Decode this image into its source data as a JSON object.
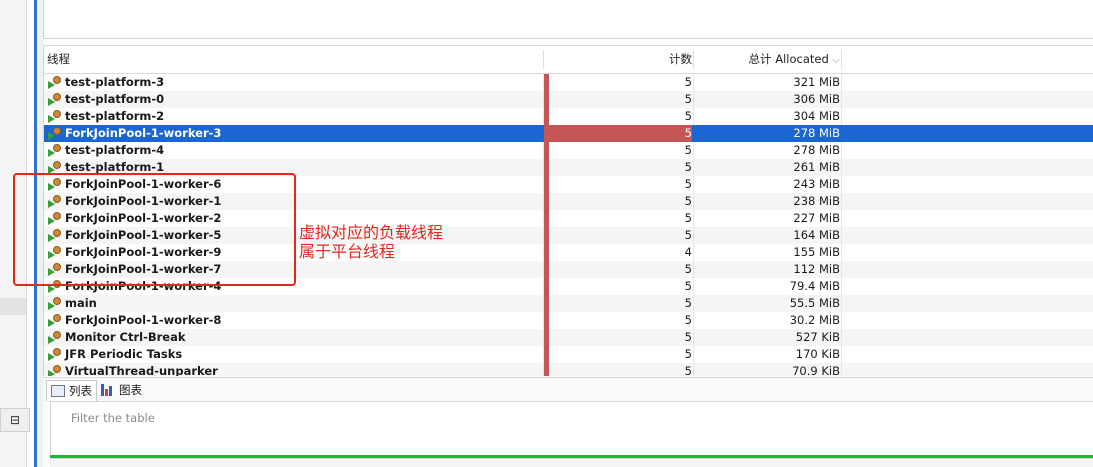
{
  "table": {
    "col_thread": "线程",
    "col_count": "计数",
    "col_alloc": "总计 Allocated",
    "sort_icon": "chevron-down-icon",
    "rows": [
      {
        "name": "test-platform-3",
        "count": "5",
        "alloc": "321 MiB"
      },
      {
        "name": "test-platform-0",
        "count": "5",
        "alloc": "306 MiB"
      },
      {
        "name": "test-platform-2",
        "count": "5",
        "alloc": "304 MiB"
      },
      {
        "name": "ForkJoinPool-1-worker-3",
        "count": "5",
        "alloc": "278 MiB"
      },
      {
        "name": "test-platform-4",
        "count": "5",
        "alloc": "278 MiB"
      },
      {
        "name": "test-platform-1",
        "count": "5",
        "alloc": "261 MiB"
      },
      {
        "name": "ForkJoinPool-1-worker-6",
        "count": "5",
        "alloc": "243 MiB"
      },
      {
        "name": "ForkJoinPool-1-worker-1",
        "count": "5",
        "alloc": "238 MiB"
      },
      {
        "name": "ForkJoinPool-1-worker-2",
        "count": "5",
        "alloc": "227 MiB"
      },
      {
        "name": "ForkJoinPool-1-worker-5",
        "count": "5",
        "alloc": "164 MiB"
      },
      {
        "name": "ForkJoinPool-1-worker-9",
        "count": "4",
        "alloc": "155 MiB"
      },
      {
        "name": "ForkJoinPool-1-worker-7",
        "count": "5",
        "alloc": "112 MiB"
      },
      {
        "name": "ForkJoinPool-1-worker-4",
        "count": "5",
        "alloc": "79.4 MiB"
      },
      {
        "name": "main",
        "count": "5",
        "alloc": "55.5 MiB"
      },
      {
        "name": "ForkJoinPool-1-worker-8",
        "count": "5",
        "alloc": "30.2 MiB"
      },
      {
        "name": "Monitor Ctrl-Break",
        "count": "5",
        "alloc": "527 KiB"
      },
      {
        "name": "JFR Periodic Tasks",
        "count": "5",
        "alloc": "170 KiB"
      },
      {
        "name": "VirtualThread-unparker",
        "count": "5",
        "alloc": "70.9 KiB"
      }
    ],
    "selected_row": "ForkJoinPool-1-worker-3"
  },
  "annotation": {
    "line1": "虚拟对应的负载线程",
    "line2": "属于平台线程"
  },
  "tabs": {
    "list_label": "列表",
    "chart_label": "图表"
  },
  "filter": {
    "placeholder": "Filter the table"
  },
  "colors": {
    "selection": "#1b66d1",
    "bar": "#c55656",
    "annotation": "#e0281f",
    "status_line": "#27b339"
  }
}
